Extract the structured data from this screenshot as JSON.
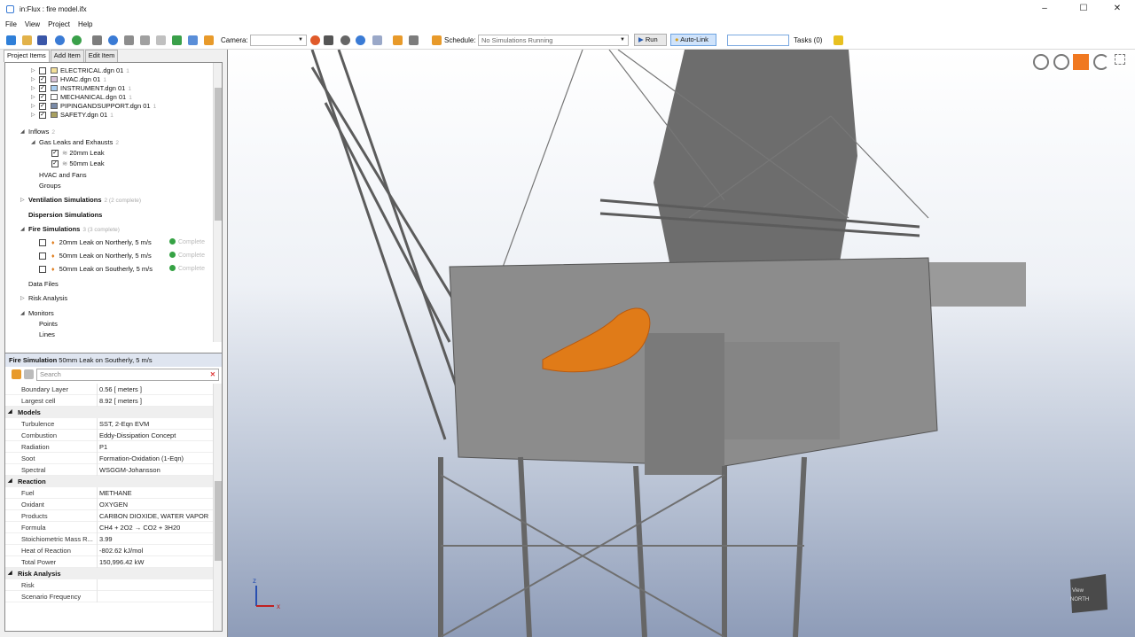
{
  "window": {
    "title": "in:Flux : fire model.ifx"
  },
  "menu": [
    "File",
    "View",
    "Project",
    "Help"
  ],
  "toolbar": {
    "camera_label": "Camera:",
    "schedule_label": "Schedule:",
    "schedule_value": "No Simulations Running",
    "run_label": "Run",
    "autolink_label": "Auto-Link",
    "tasks_label": "Tasks (0)"
  },
  "tabs": [
    "Project Items",
    "Add Item",
    "Edit Item"
  ],
  "tree": {
    "dgn": [
      {
        "label": "ELECTRICAL.dgn 01",
        "count": "1",
        "checked": false,
        "color": "#f3df9a"
      },
      {
        "label": "HVAC.dgn 01",
        "count": "1",
        "checked": true,
        "color": "#d8c2d8"
      },
      {
        "label": "INSTRUMENT.dgn 01",
        "count": "1",
        "checked": true,
        "color": "#a8cdf0"
      },
      {
        "label": "MECHANICAL.dgn 01",
        "count": "1",
        "checked": true,
        "color": "#ffffff"
      },
      {
        "label": "PIPINGANDSUPPORT.dgn 01",
        "count": "1",
        "checked": true,
        "color": "#7a8ba8"
      },
      {
        "label": "SAFETY.dgn 01",
        "count": "1",
        "checked": true,
        "color": "#a9a060"
      }
    ],
    "inflows": {
      "label": "Inflows",
      "count": "2"
    },
    "gas_leaks": {
      "label": "Gas Leaks and Exhausts",
      "count": "2"
    },
    "leaks": [
      "20mm Leak",
      "50mm Leak"
    ],
    "hvac": "HVAC and Fans",
    "groups": "Groups",
    "ventilation": {
      "label": "Ventilation Simulations",
      "count": "2 (2 complete)"
    },
    "dispersion": "Dispersion Simulations",
    "fire": {
      "label": "Fire Simulations",
      "count": "3 (3 complete)"
    },
    "fire_items": [
      {
        "label": "20mm Leak on Northerly, 5 m/s",
        "status": "Complete"
      },
      {
        "label": "50mm Leak on Northerly, 5 m/s",
        "status": "Complete"
      },
      {
        "label": "50mm Leak on Southerly, 5 m/s",
        "status": "Complete"
      }
    ],
    "data_files": "Data Files",
    "risk": "Risk Analysis",
    "monitors": "Monitors",
    "points": "Points",
    "lines": "Lines"
  },
  "properties": {
    "header_type": "Fire Simulation",
    "header_name": "50mm Leak on Southerly, 5 m/s",
    "search_placeholder": "Search",
    "top_rows": [
      {
        "k": "Boundary Layer",
        "v": "0.56 [ meters ]"
      },
      {
        "k": "Largest cell",
        "v": "8.92 [ meters ]"
      }
    ],
    "models_label": "Models",
    "models": [
      {
        "k": "Turbulence",
        "v": "SST, 2-Eqn EVM"
      },
      {
        "k": "Combustion",
        "v": "Eddy-Dissipation Concept"
      },
      {
        "k": "Radiation",
        "v": "P1"
      },
      {
        "k": "Soot",
        "v": "Formation-Oxidation (1-Eqn)"
      },
      {
        "k": "Spectral",
        "v": "WSGGM-Johansson"
      }
    ],
    "reaction_label": "Reaction",
    "reaction": [
      {
        "k": "Fuel",
        "v": "METHANE"
      },
      {
        "k": "Oxidant",
        "v": "OXYGEN"
      },
      {
        "k": "Products",
        "v": "CARBON DIOXIDE, WATER VAPOR"
      },
      {
        "k": "Formula",
        "v": "CH4 + 2O2 → CO2 + 3H20"
      },
      {
        "k": "Stoichiometric Mass R...",
        "v": "3.99"
      },
      {
        "k": "Heat of Reaction",
        "v": "-802.62 kJ/mol"
      },
      {
        "k": "Total Power",
        "v": "150,996.42 kW"
      }
    ],
    "risk_label": "Risk Analysis",
    "risk": [
      {
        "k": "Risk",
        "v": ""
      },
      {
        "k": "Scenario Frequency",
        "v": ""
      }
    ]
  },
  "viewport": {
    "cube_top": "View",
    "cube_bottom": "NORTH",
    "axis_z": "z",
    "axis_x": "x"
  },
  "colors": {
    "accent": "#3a7bd5",
    "complete": "#35a244",
    "flame": "#e07b18",
    "steel": "#8c8c8c"
  }
}
